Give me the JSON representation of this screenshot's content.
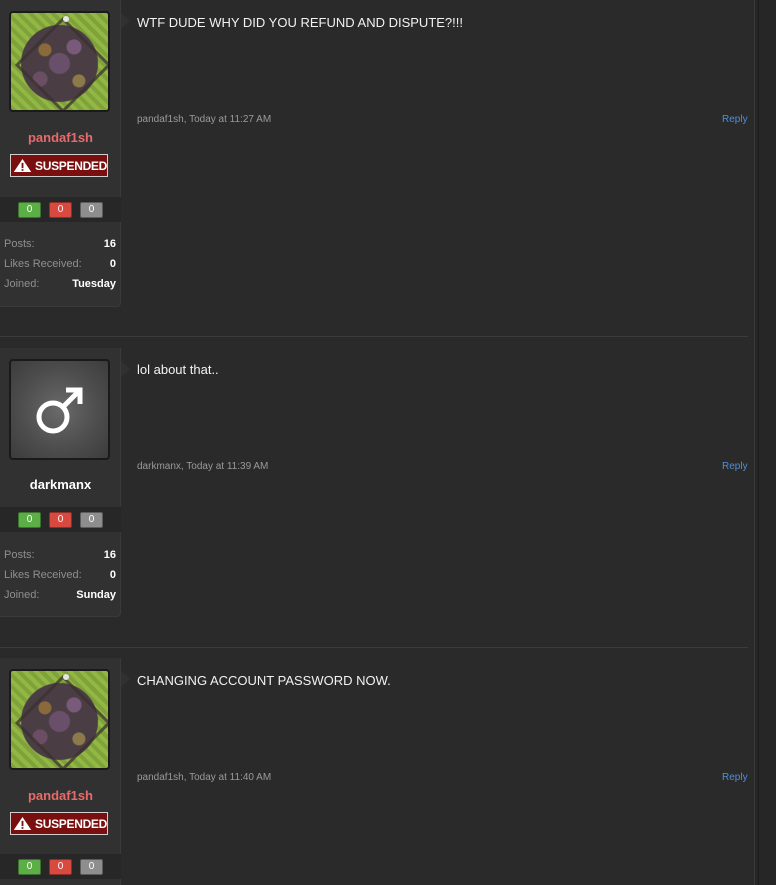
{
  "posts": [
    {
      "username": "pandaf1sh",
      "user_banner": "SUSPENDED",
      "reputation": [
        "0",
        "0",
        "0"
      ],
      "stats": [
        {
          "label": "Posts:",
          "value": "16"
        },
        {
          "label": "Likes Received:",
          "value": "0"
        },
        {
          "label": "Joined:",
          "value": "Tuesday"
        }
      ],
      "message": "WTF DUDE WHY DID YOU REFUND AND DISPUTE?!!!",
      "author_line": "pandaf1sh, Today at 11:27 AM",
      "reply_label": "Reply"
    },
    {
      "username": "darkmanx",
      "reputation": [
        "0",
        "0",
        "0"
      ],
      "stats": [
        {
          "label": "Posts:",
          "value": "16"
        },
        {
          "label": "Likes Received:",
          "value": "0"
        },
        {
          "label": "Joined:",
          "value": "Sunday"
        }
      ],
      "message": "lol about that..",
      "author_line": "darkmanx, Today at 11:39 AM",
      "reply_label": "Reply"
    },
    {
      "username": "pandaf1sh",
      "user_banner": "SUSPENDED",
      "reputation": [
        "0",
        "0",
        "0"
      ],
      "message": "CHANGING ACCOUNT PASSWORD NOW.",
      "author_line": "pandaf1sh, Today at 11:40 AM",
      "reply_label": "Reply"
    }
  ],
  "colors": {
    "suspended_username": "#e86b6b",
    "reply_link": "#4f8fd8",
    "rep_positive": "#5cae47",
    "rep_negative": "#d8493f",
    "rep_neutral": "#8e8e8e"
  }
}
